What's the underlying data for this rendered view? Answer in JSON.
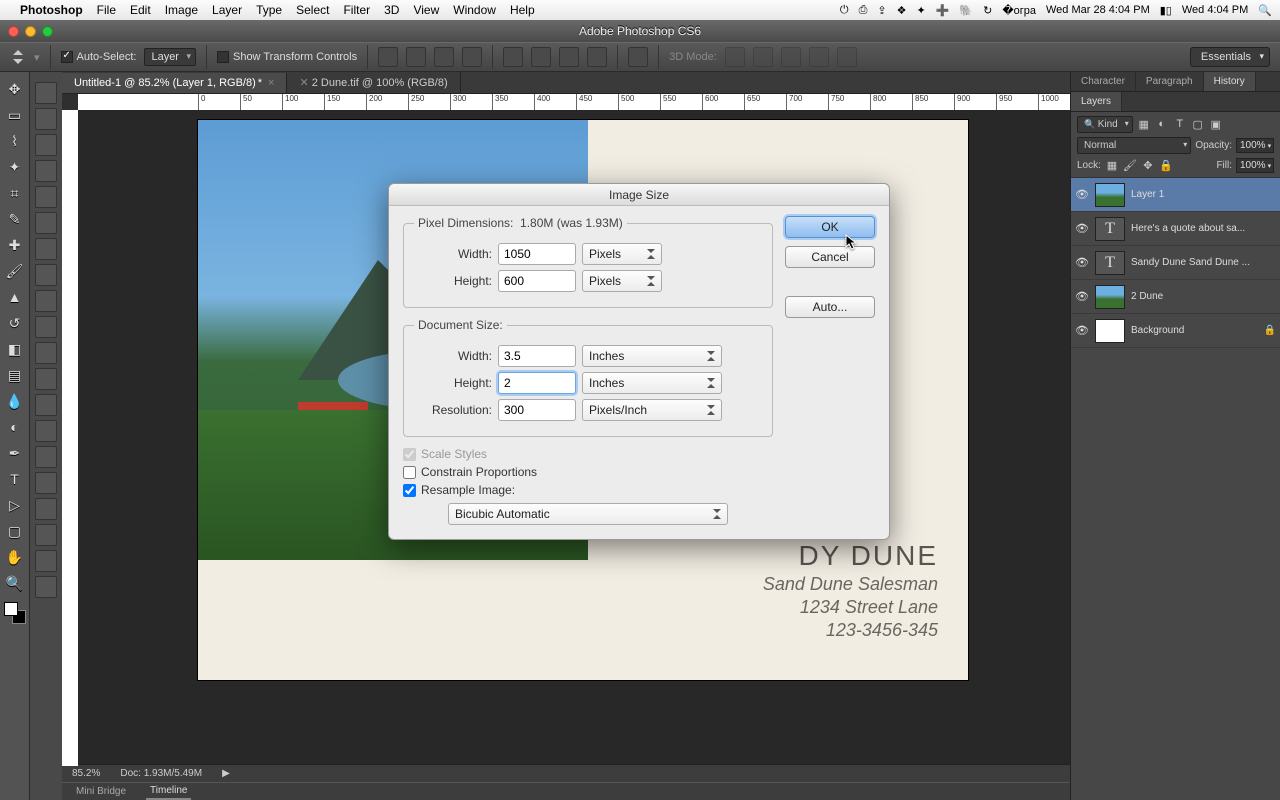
{
  "menubar": {
    "app": "Photoshop",
    "items": [
      "File",
      "Edit",
      "Image",
      "Layer",
      "Type",
      "Select",
      "Filter",
      "3D",
      "View",
      "Window",
      "Help"
    ],
    "clock1": "Wed Mar 28  4:04 PM",
    "clock2": "Wed  4:04 PM"
  },
  "window": {
    "title": "Adobe Photoshop CS6"
  },
  "options": {
    "auto_select_label": "Auto-Select:",
    "auto_select_target": "Layer",
    "show_transform_label": "Show Transform Controls",
    "mode3d_label": "3D Mode:",
    "workspace": "Essentials"
  },
  "docs": {
    "tab1": "Untitled-1 @ 85.2% (Layer 1, RGB/8)",
    "tab1_mod": "*",
    "tab2": "2 Dune.tif @ 100% (RGB/8)"
  },
  "ruler_ticks": [
    "0",
    "50",
    "100",
    "150",
    "200",
    "250",
    "300",
    "350",
    "400",
    "450",
    "500",
    "550",
    "600",
    "650",
    "700",
    "750",
    "800",
    "850",
    "900",
    "950",
    "1000"
  ],
  "artboard": {
    "title": "DY DUNE",
    "sub": "Sand Dune Salesman",
    "line1": "1234 Street Lane",
    "line2": "123-3456-345"
  },
  "status": {
    "zoom": "85.2%",
    "docinfo": "Doc: 1.93M/5.49M"
  },
  "footer": {
    "tab1": "Mini Bridge",
    "tab2": "Timeline"
  },
  "panelTabs": {
    "t1": "Character",
    "t2": "Paragraph",
    "t3": "History",
    "t4": "Layers"
  },
  "layerOpts": {
    "kind": "Kind",
    "blend": "Normal",
    "opacity_lbl": "Opacity:",
    "opacity": "100%",
    "lock_lbl": "Lock:",
    "fill_lbl": "Fill:",
    "fill": "100%"
  },
  "layers": [
    {
      "name": "Layer 1",
      "type": "img",
      "sel": true
    },
    {
      "name": "Here's a quote about sa...",
      "type": "txt"
    },
    {
      "name": "Sandy Dune Sand Dune ...",
      "type": "txt"
    },
    {
      "name": "2 Dune",
      "type": "img"
    },
    {
      "name": "Background",
      "type": "white",
      "locked": true
    }
  ],
  "dialog": {
    "title": "Image Size",
    "pixdim_label": "Pixel Dimensions:",
    "pixdim_value": "1.80M (was 1.93M)",
    "width_lbl": "Width:",
    "height_lbl": "Height:",
    "res_lbl": "Resolution:",
    "px_w": "1050",
    "px_h": "600",
    "px_unit": "Pixels",
    "doc_label": "Document Size:",
    "doc_w": "3.5",
    "doc_h": "2",
    "doc_unit": "Inches",
    "res": "300",
    "res_unit": "Pixels/Inch",
    "scale_lbl": "Scale Styles",
    "constrain_lbl": "Constrain Proportions",
    "resample_lbl": "Resample Image:",
    "method": "Bicubic Automatic",
    "ok": "OK",
    "cancel": "Cancel",
    "auto": "Auto..."
  }
}
